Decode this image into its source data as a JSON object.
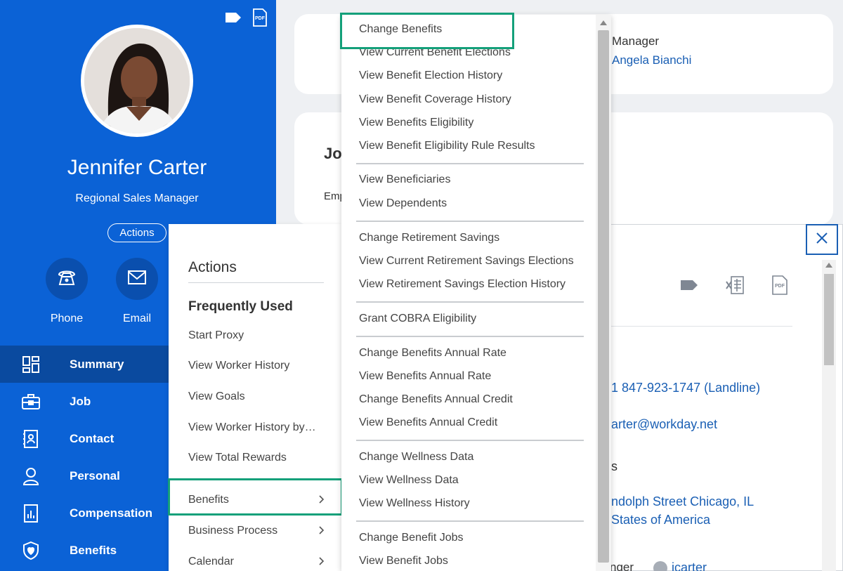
{
  "colors": {
    "brand_blue": "#0b62d6",
    "nav_active": "#0a4a9f",
    "highlight_green": "#14a07a",
    "link_blue": "#1a5fb4"
  },
  "profile": {
    "name": "Jennifer Carter",
    "title": "Regional Sales Manager",
    "actions_label": "Actions",
    "top_icons": [
      "tag-icon",
      "pdf-icon"
    ],
    "pdf_icon_text": "PDF",
    "contact_buttons": [
      {
        "label": "Phone",
        "icon": "phone-icon"
      },
      {
        "label": "Email",
        "icon": "mail-icon"
      }
    ]
  },
  "nav": {
    "items": [
      {
        "label": "Summary",
        "icon": "grid-icon",
        "active": true
      },
      {
        "label": "Job",
        "icon": "briefcase-icon",
        "active": false
      },
      {
        "label": "Contact",
        "icon": "contact-card-icon",
        "active": false
      },
      {
        "label": "Personal",
        "icon": "person-icon",
        "active": false
      },
      {
        "label": "Compensation",
        "icon": "chart-icon",
        "active": false
      },
      {
        "label": "Benefits",
        "icon": "shield-icon",
        "active": false
      }
    ]
  },
  "background": {
    "manager_label": "Manager",
    "manager_value": "Angela Bianchi",
    "job_heading": "Jo",
    "job_emp_label": "Emp"
  },
  "related": {
    "pdf_icon_text": "PDF",
    "phone": "1 847-923-1747 (Landline)",
    "email": "arter@workday.net",
    "address_label": "s",
    "address_line1": "ndolph Street Chicago, IL",
    "address_line2": "States of America",
    "bottom_label": "nger",
    "bottom_value": "jcarter"
  },
  "actions_menu": {
    "heading": "Actions",
    "frequently_used_heading": "Frequently Used",
    "frequently_used": [
      "Start Proxy",
      "View Worker History",
      "View Goals",
      "View Worker History by…",
      "View Total Rewards"
    ],
    "submenus": [
      "Benefits",
      "Business Process",
      "Calendar"
    ]
  },
  "benefits_submenu": {
    "groups": [
      [
        "Change Benefits",
        "View Current Benefit Elections",
        "View Benefit Election History",
        "View Benefit Coverage History",
        "View Benefits Eligibility",
        "View Benefit Eligibility Rule Results"
      ],
      [
        "View Beneficiaries",
        "View Dependents"
      ],
      [
        "Change Retirement Savings",
        "View Current Retirement Savings Elections",
        "View Retirement Savings Election History"
      ],
      [
        "Grant COBRA Eligibility"
      ],
      [
        "Change Benefits Annual Rate",
        "View Benefits Annual Rate",
        "Change Benefits Annual Credit",
        "View Benefits Annual Credit"
      ],
      [
        "Change Wellness Data",
        "View Wellness Data",
        "View Wellness History"
      ],
      [
        "Change Benefit Jobs",
        "View Benefit Jobs"
      ]
    ]
  }
}
